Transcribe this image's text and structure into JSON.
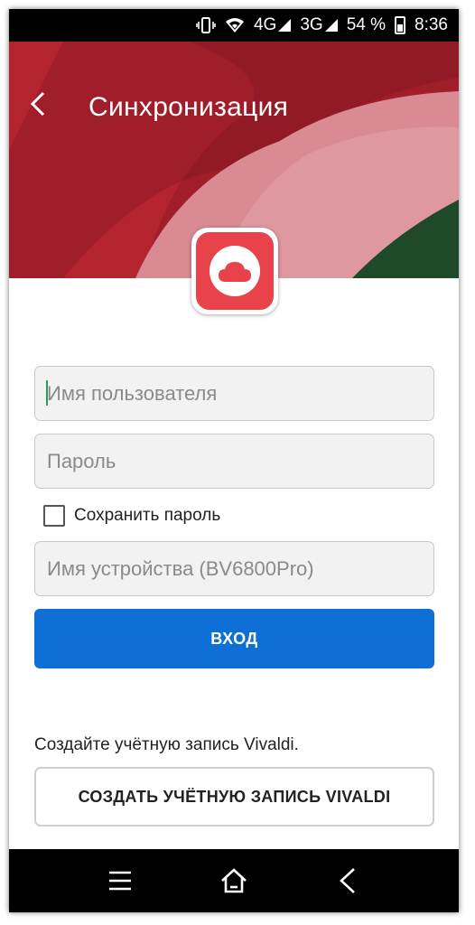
{
  "status_bar": {
    "network_1": "4G",
    "network_2": "3G",
    "battery": "54 %",
    "time": "8:36"
  },
  "header": {
    "title": "Синхронизация",
    "back_icon": "chevron-left-icon"
  },
  "logo": {
    "icon": "cloud-icon",
    "color": "#e8434a"
  },
  "form": {
    "username_placeholder": "Имя пользователя",
    "password_placeholder": "Пароль",
    "remember_label": "Сохранить пароль",
    "remember_checked": false,
    "device_placeholder": "Имя устройства (BV6800Pro)",
    "login_label": "ВХОД"
  },
  "create_account": {
    "hint": "Создайте учётную запись Vivaldi.",
    "button_label": "СОЗДАТЬ УЧЁТНУЮ ЗАПИСЬ VIVALDI"
  },
  "nav_bar": {
    "icons": [
      "menu-icon",
      "home-icon",
      "back-icon"
    ]
  },
  "colors": {
    "accent": "#0e6fd6",
    "header_red": "#b3242f",
    "header_pink": "#d98a93",
    "header_green": "#1f4a2a"
  }
}
